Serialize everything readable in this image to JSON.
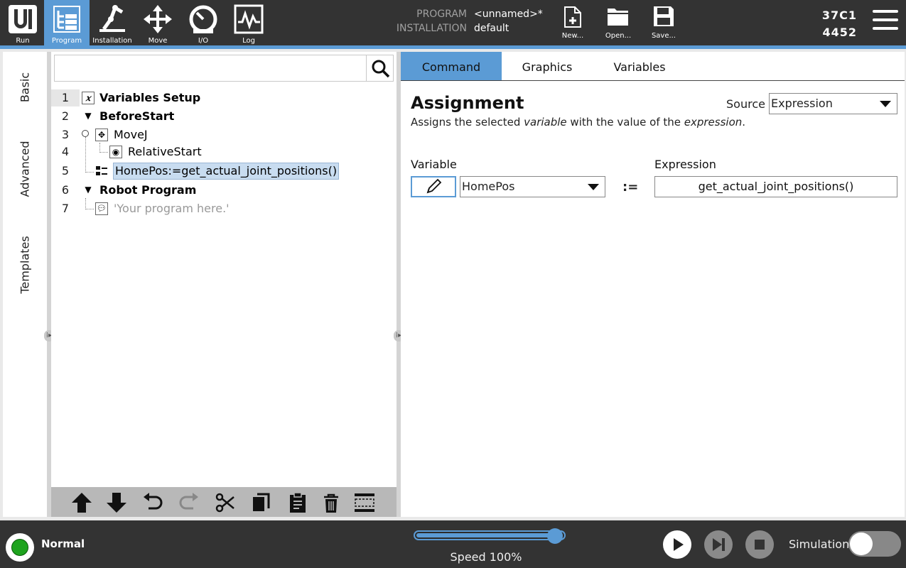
{
  "header": {
    "nav": [
      {
        "label": "Run",
        "icon": "ur-logo-icon"
      },
      {
        "label": "Program",
        "icon": "program-tree-icon"
      },
      {
        "label": "Installation",
        "icon": "robot-arm-icon"
      },
      {
        "label": "Move",
        "icon": "move-arrows-icon"
      },
      {
        "label": "I/O",
        "icon": "io-gauge-icon"
      },
      {
        "label": "Log",
        "icon": "log-waveform-icon"
      }
    ],
    "program_key": "PROGRAM",
    "program_value": "<unnamed>*",
    "installation_key": "INSTALLATION",
    "installation_value": "default",
    "file_buttons": [
      {
        "label": "New...",
        "icon": "new-file-icon"
      },
      {
        "label": "Open...",
        "icon": "open-folder-icon"
      },
      {
        "label": "Save...",
        "icon": "save-disk-icon"
      }
    ],
    "serial_line1": "37C1",
    "serial_line2": "4452"
  },
  "sidebar": {
    "tabs": [
      "Basic",
      "Advanced",
      "Templates"
    ]
  },
  "tree": {
    "search_placeholder": "",
    "rows": [
      {
        "num": "1",
        "text": "Variables Setup",
        "icon": "x"
      },
      {
        "num": "2",
        "text": "BeforeStart",
        "icon": "▼"
      },
      {
        "num": "3",
        "text": "MoveJ",
        "icon": "move"
      },
      {
        "num": "4",
        "text": "RelativeStart",
        "icon": "waypoint"
      },
      {
        "num": "5",
        "text": "HomePos:=get_actual_joint_positions()",
        "icon": "assign"
      },
      {
        "num": "6",
        "text": "Robot Program",
        "icon": "▼"
      },
      {
        "num": "7",
        "text": "'Your program here.'",
        "icon": "comment"
      }
    ]
  },
  "command": {
    "tabs": [
      "Command",
      "Graphics",
      "Variables"
    ],
    "title": "Assignment",
    "desc_prefix": "Assigns the selected ",
    "desc_var": "variable",
    "desc_mid": " with the value of the ",
    "desc_expr": "expression",
    "desc_suffix": ".",
    "source_label": "Source",
    "source_value": "Expression",
    "variable_label": "Variable",
    "variable_value": "HomePos",
    "assign_op": ":=",
    "expression_label": "Expression",
    "expression_value": "get_actual_joint_positions()"
  },
  "footer": {
    "status": "Normal",
    "speed_text": "Speed 100%",
    "speed_fraction": 1.0,
    "simulation_label": "Simulation",
    "simulation_on": false
  },
  "colors": {
    "accent": "#5b9bd5",
    "bar_dark": "#333333",
    "status_ok": "#1ea31e"
  }
}
